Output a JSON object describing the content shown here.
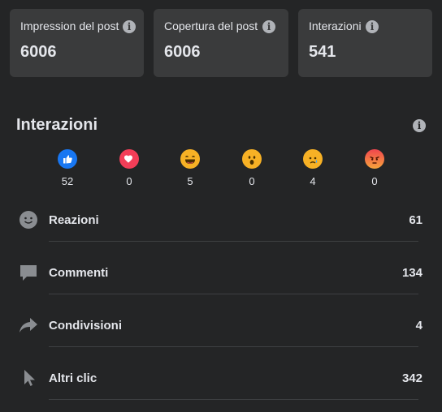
{
  "cards": [
    {
      "label": "Impression del post",
      "value": "6006"
    },
    {
      "label": "Copertura del post",
      "value": "6006"
    },
    {
      "label": "Interazioni",
      "value": "541"
    }
  ],
  "section": {
    "title": "Interazioni"
  },
  "reactions": [
    {
      "name": "like",
      "icon": "like-icon",
      "count": "52"
    },
    {
      "name": "love",
      "icon": "love-icon",
      "count": "0"
    },
    {
      "name": "haha",
      "icon": "haha-icon",
      "count": "5"
    },
    {
      "name": "wow",
      "icon": "wow-icon",
      "count": "0"
    },
    {
      "name": "sad",
      "icon": "sad-icon",
      "count": "4"
    },
    {
      "name": "angry",
      "icon": "angry-icon",
      "count": "0"
    }
  ],
  "metrics": [
    {
      "label": "Reazioni",
      "value": "61",
      "icon": "smiley-icon"
    },
    {
      "label": "Commenti",
      "value": "134",
      "icon": "comment-icon"
    },
    {
      "label": "Condivisioni",
      "value": "4",
      "icon": "share-icon"
    },
    {
      "label": "Altri clic",
      "value": "342",
      "icon": "cursor-icon"
    }
  ],
  "colors": {
    "background": "#242526",
    "card": "#3a3b3c",
    "like": "#1877f2",
    "love": "#f33e58",
    "emoji": "#f7b125",
    "angry": "#e9710f"
  }
}
